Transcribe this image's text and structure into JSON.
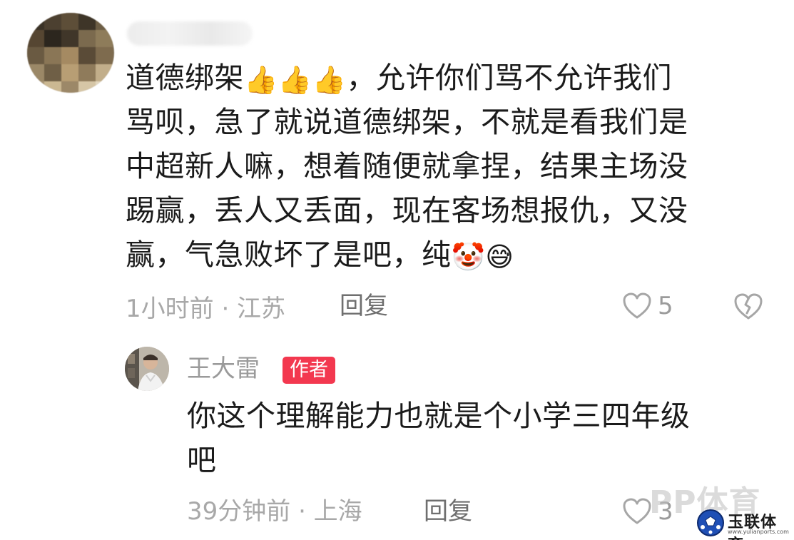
{
  "comment": {
    "username": "",
    "segments": [
      {
        "type": "text",
        "value": "道德绑架"
      },
      {
        "type": "emoji",
        "value": "👍"
      },
      {
        "type": "emoji",
        "value": "👍"
      },
      {
        "type": "emoji",
        "value": "👍"
      },
      {
        "type": "text",
        "value": "，允许你们骂不允许我们骂呗，急了就说道德绑架，不就是看我们是中超新人嘛，想着随便就拿捏，结果主场没踢赢，丢人又丢面，现在客场想报仇，又没赢，气急败坏了是吧，纯"
      },
      {
        "type": "emoji",
        "value": "🤡"
      },
      {
        "type": "emoji",
        "value": "😅"
      }
    ],
    "line1": "道德绑架",
    "line1b": "，允许你们骂不允许我们",
    "line2": "骂呗，急了就说道德绑架，不就是看我们是",
    "line3": "中超新人嘛，想着随便就拿捏，结果主场没",
    "line4": "踢赢，丢人又丢面，现在客场想报仇，又没",
    "line5": "赢，气急败坏了是吧，纯",
    "thumbs_emoji": "👍",
    "clown_emoji": "🤡",
    "sweat_emoji": "😅",
    "meta": "1小时前 · 江苏",
    "reply_label": "回复",
    "like_count": "5",
    "icons": {
      "like": "heart-outline-icon",
      "dislike": "broken-heart-icon"
    }
  },
  "reply": {
    "username": "王大雷",
    "badge": "作者",
    "line1": "你这个理解能力也就是个小学三四年级",
    "line2": "吧",
    "meta": "39分钟前 · 上海",
    "reply_label": "回复",
    "like_count": "3",
    "badge_color": "#f3384f"
  },
  "watermarks": {
    "pp": "PP体育",
    "logo_text": "玉联体育",
    "logo_url": "www.yulianports.com"
  },
  "colors": {
    "text_primary": "#1b1b1b",
    "text_meta": "#a8a8a8",
    "text_reply_btn": "#6f6f6f"
  }
}
